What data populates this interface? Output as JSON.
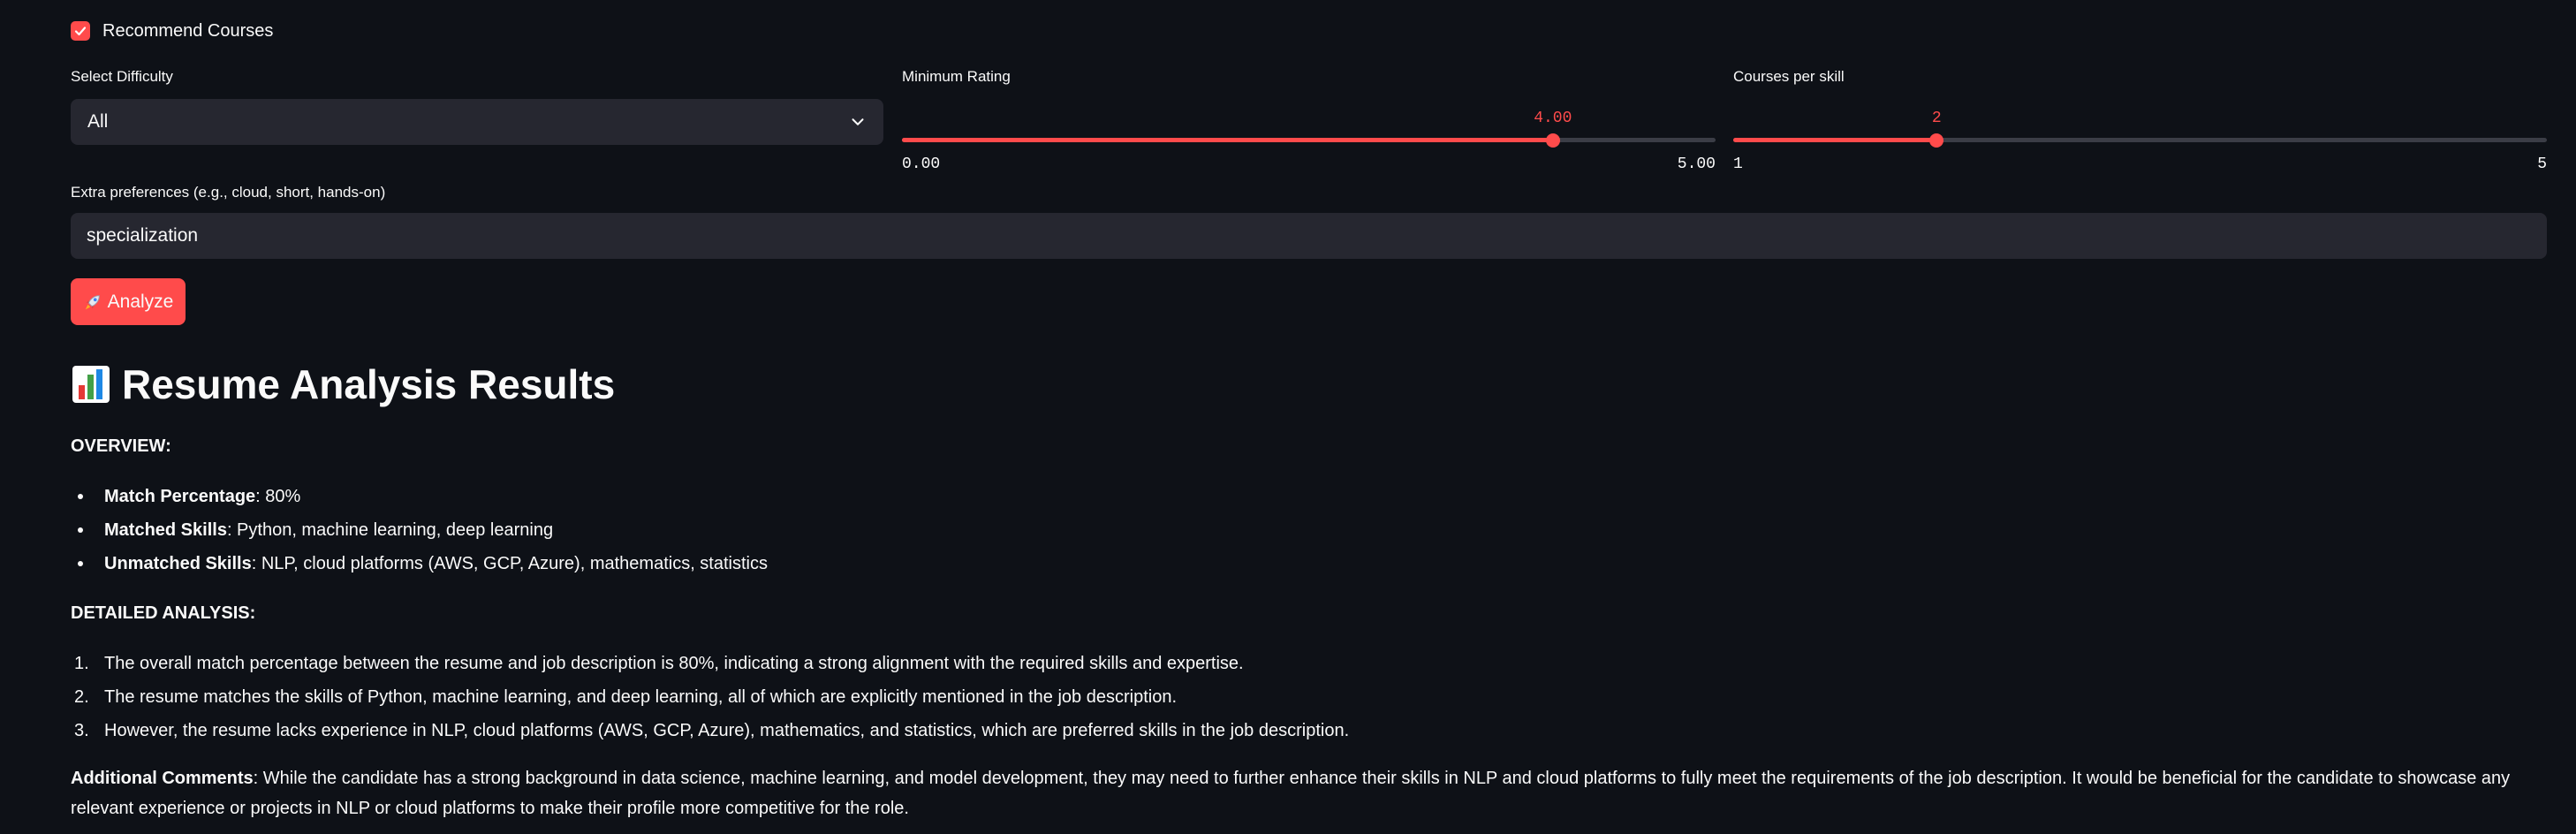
{
  "options": {
    "recommend_courses_label": "Recommend Courses",
    "recommend_courses_checked": true
  },
  "difficulty": {
    "label": "Select Difficulty",
    "value": "All"
  },
  "min_rating": {
    "label": "Minimum Rating",
    "value": "4.00",
    "value_number": 4.0,
    "min": "0.00",
    "max": "5.00",
    "min_number": 0,
    "max_number": 5
  },
  "courses_per_skill": {
    "label": "Courses per skill",
    "value": "2",
    "value_number": 2,
    "min": "1",
    "max": "5",
    "min_number": 1,
    "max_number": 5
  },
  "preferences": {
    "label": "Extra preferences (e.g., cloud, short, hands-on)",
    "value": "specialization"
  },
  "analyze_button": {
    "label": "Analyze",
    "icon": "rocket-icon"
  },
  "results": {
    "title": "Resume Analysis Results",
    "title_icon": "bar-chart-icon",
    "overview_heading": "OVERVIEW:",
    "overview": [
      {
        "key": "Match Percentage",
        "value": ": 80%"
      },
      {
        "key": "Matched Skills",
        "value": ": Python, machine learning, deep learning"
      },
      {
        "key": "Unmatched Skills",
        "value": ": NLP, cloud platforms (AWS, GCP, Azure), mathematics, statistics"
      }
    ],
    "detailed_heading": "DETAILED ANALYSIS:",
    "detailed": [
      {
        "num": "1.",
        "text": "The overall match percentage between the resume and job description is 80%, indicating a strong alignment with the required skills and expertise."
      },
      {
        "num": "2.",
        "text": "The resume matches the skills of Python, machine learning, and deep learning, all of which are explicitly mentioned in the job description."
      },
      {
        "num": "3.",
        "text": "However, the resume lacks experience in NLP, cloud platforms (AWS, GCP, Azure), mathematics, and statistics, which are preferred skills in the job description."
      }
    ],
    "comments_key": "Additional Comments",
    "comments_text": ": While the candidate has a strong background in data science, machine learning, and model development, they may need to further enhance their skills in NLP and cloud platforms to fully meet the requirements of the job description. It would be beneficial for the candidate to showcase any relevant experience or projects in NLP or cloud platforms to make their profile more competitive for the role."
  },
  "colors": {
    "background": "#0e1117",
    "accent": "#ff4b4b",
    "input_bg": "#262730",
    "text": "#fafafa"
  }
}
